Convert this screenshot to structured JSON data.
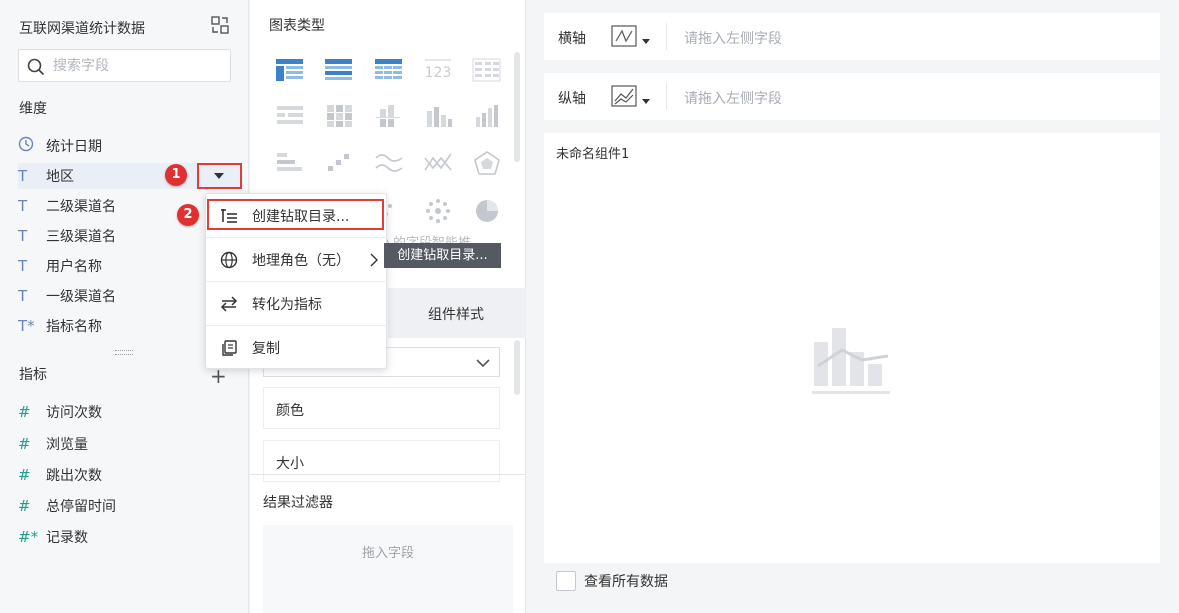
{
  "dataset": {
    "title": "互联网渠道统计数据",
    "search_placeholder": "搜索字段",
    "dimension_label": "维度",
    "measure_label": "指标",
    "dimensions": [
      {
        "type": "time",
        "type_glyph": "",
        "label": "统计日期"
      },
      {
        "type": "text",
        "type_glyph": "T",
        "label": "地区"
      },
      {
        "type": "text",
        "type_glyph": "T",
        "label": "二级渠道名"
      },
      {
        "type": "text",
        "type_glyph": "T",
        "label": "三级渠道名"
      },
      {
        "type": "text",
        "type_glyph": "T",
        "label": "用户名称"
      },
      {
        "type": "text",
        "type_glyph": "T",
        "label": "一级渠道名"
      },
      {
        "type": "text",
        "type_glyph": "T*",
        "label": "指标名称"
      }
    ],
    "measures": [
      {
        "type_glyph": "#",
        "label": "访问次数"
      },
      {
        "type_glyph": "#",
        "label": "浏览量"
      },
      {
        "type_glyph": "#",
        "label": "跳出次数"
      },
      {
        "type_glyph": "#",
        "label": "总停留时间"
      },
      {
        "type_glyph": "#*",
        "label": "记录数"
      }
    ]
  },
  "annotations": {
    "step1": "1",
    "step2": "2"
  },
  "chart_panel": {
    "title": "图表类型",
    "hint_partial": "入的字段智能推",
    "tab_style": "组件样式",
    "properties": [
      "颜色",
      "大小"
    ],
    "filter_title": "结果过滤器",
    "drop_hint": "拖入字段"
  },
  "context_menu": {
    "items": [
      {
        "icon": "drill-directory-icon",
        "label": "创建钻取目录..."
      },
      {
        "icon": "globe-icon",
        "label": "地理角色（无）"
      },
      {
        "icon": "convert-icon",
        "label": "转化为指标"
      },
      {
        "icon": "copy-icon",
        "label": "复制"
      }
    ],
    "tooltip": "创建钻取目录..."
  },
  "canvas": {
    "x_axis_label": "横轴",
    "y_axis_label": "纵轴",
    "axis_placeholder": "请拖入左侧字段",
    "component_name": "未命名组件1",
    "view_all_label": "查看所有数据"
  },
  "colors": {
    "highlight": "#e33a3a",
    "badge": "#e0302f",
    "measure": "#1f9f8c",
    "dimension": "#6a86b8"
  }
}
